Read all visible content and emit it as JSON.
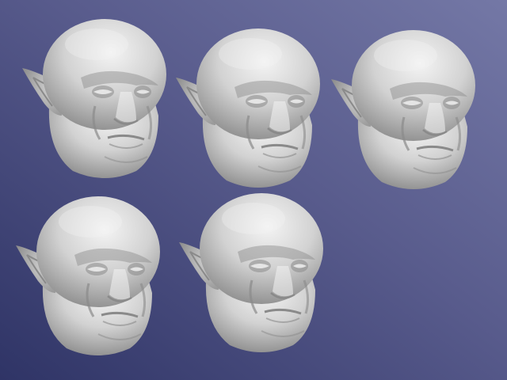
{
  "scene": {
    "background_gradient": [
      "#2f3466",
      "#585b8c",
      "#7478a6"
    ],
    "surface_color": "#d2d2d2",
    "shade_color": "#8a8a8a",
    "highlight_color": "#f4f4f4"
  },
  "models": [
    {
      "id": "head-1",
      "type": "sculpted-orc-head",
      "variant": "base"
    },
    {
      "id": "head-2",
      "type": "sculpted-orc-head",
      "variant": "variant-a"
    },
    {
      "id": "head-3",
      "type": "sculpted-orc-head",
      "variant": "variant-b"
    },
    {
      "id": "head-4",
      "type": "sculpted-orc-head",
      "variant": "variant-c"
    },
    {
      "id": "head-5",
      "type": "sculpted-orc-head",
      "variant": "variant-d"
    }
  ]
}
